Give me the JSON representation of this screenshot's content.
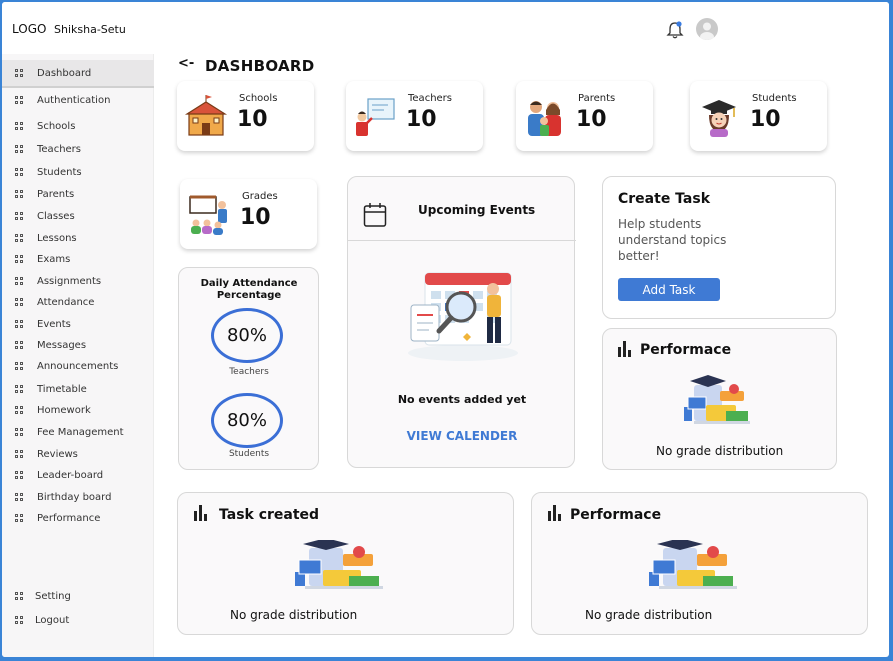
{
  "header": {
    "logo": "LOGO",
    "brand": "Shiksha-Setu"
  },
  "sidebar": {
    "items": [
      {
        "label": "Dashboard"
      },
      {
        "label": "Authentication"
      },
      {
        "label": "Schools"
      },
      {
        "label": "Teachers"
      },
      {
        "label": "Students"
      },
      {
        "label": "Parents"
      },
      {
        "label": "Classes"
      },
      {
        "label": "Lessons"
      },
      {
        "label": "Exams"
      },
      {
        "label": "Assignments"
      },
      {
        "label": "Attendance"
      },
      {
        "label": "Events"
      },
      {
        "label": "Messages"
      },
      {
        "label": "Announcements"
      },
      {
        "label": "Timetable"
      },
      {
        "label": "Homework"
      },
      {
        "label": "Fee Management"
      },
      {
        "label": "Reviews"
      },
      {
        "label": "Leader-board"
      },
      {
        "label": "Birthday board"
      },
      {
        "label": "Performance"
      }
    ],
    "bottom": [
      {
        "label": "Setting"
      },
      {
        "label": "Logout"
      }
    ]
  },
  "page": {
    "back": "<-",
    "title": "DASHBOARD"
  },
  "stats": {
    "schools": {
      "label": "Schools",
      "value": "10"
    },
    "teachers": {
      "label": "Teachers",
      "value": "10"
    },
    "parents": {
      "label": "Parents",
      "value": "10"
    },
    "students": {
      "label": "Students",
      "value": "10"
    },
    "grades": {
      "label": "Grades",
      "value": "10"
    }
  },
  "attendance": {
    "title": "Daily Attendance Percentage",
    "teachers": {
      "value": "80%",
      "label": "Teachers"
    },
    "students": {
      "value": "80%",
      "label": "Students"
    }
  },
  "events": {
    "title": "Upcoming Events",
    "empty": "No events added yet",
    "link": "VIEW CALENDER"
  },
  "create_task": {
    "title": "Create Task",
    "text": "Help students understand topics better!",
    "button": "Add Task"
  },
  "performance_small": {
    "title": "Performace",
    "empty": "No grade distribution"
  },
  "task_created": {
    "title": "Task created",
    "empty": "No grade distribution"
  },
  "performance_large": {
    "title": "Performace",
    "empty": "No grade distribution"
  },
  "colors": {
    "accent": "#3f7ad4",
    "frame": "#3a84d6",
    "ring": "#3b6fd6"
  }
}
